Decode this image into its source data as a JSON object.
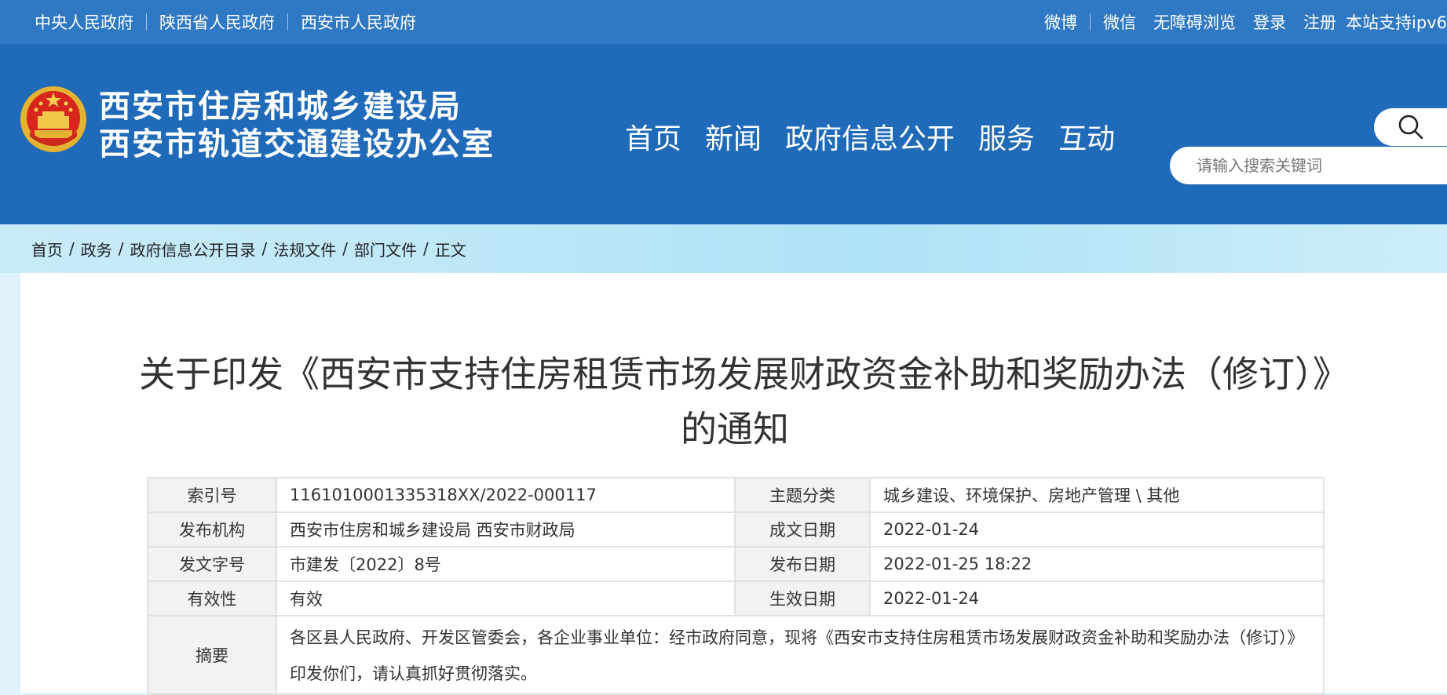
{
  "topbar": {
    "left_links": [
      "中央人民政府",
      "陕西省人民政府",
      "西安市人民政府"
    ],
    "right_links": [
      "微博",
      "微信",
      "无障碍浏览",
      "登录",
      "注册",
      "本站支持ipv6"
    ]
  },
  "header": {
    "title_line1": "西安市住房和城乡建设局",
    "title_line2": "西安市轨道交通建设办公室",
    "nav": [
      "首页",
      "新闻",
      "政府信息公开",
      "服务",
      "互动"
    ],
    "search_placeholder": "请输入搜索关键词"
  },
  "breadcrumb": [
    "首页",
    "政务",
    "政府信息公开目录",
    "法规文件",
    "部门文件",
    "正文"
  ],
  "document": {
    "title": "关于印发《西安市支持住房租赁市场发展财政资金补助和奖励办法（修订）》的通知",
    "meta": {
      "index_label": "索引号",
      "index_value": "1161010001335318XX/2022-000117",
      "topic_label": "主题分类",
      "topic_value": "城乡建设、环境保护、房地产管理 \\ 其他",
      "publisher_label": "发布机构",
      "publisher_value": "西安市住房和城乡建设局 西安市财政局",
      "created_label": "成文日期",
      "created_value": "2022-01-24",
      "docno_label": "发文字号",
      "docno_value": "市建发〔2022〕8号",
      "published_label": "发布日期",
      "published_value": "2022-01-25 18:22",
      "validity_label": "有效性",
      "validity_value": "有效",
      "effective_label": "生效日期",
      "effective_value": "2022-01-24",
      "summary_label": "摘要",
      "summary_value": "各区县人民政府、开发区管委会，各企业事业单位：经市政府同意，现将《西安市支持住房租赁市场发展财政资金补助和奖励办法（修订）》印发你们，请认真抓好贯彻落实。"
    }
  },
  "colors": {
    "topbar": "#2f78c4",
    "header": "#1f6ab9",
    "label_bg": "#f2f2f2",
    "border": "#e1e1e1"
  },
  "icons": {
    "emblem": "national-emblem-icon",
    "search": "search-icon"
  }
}
